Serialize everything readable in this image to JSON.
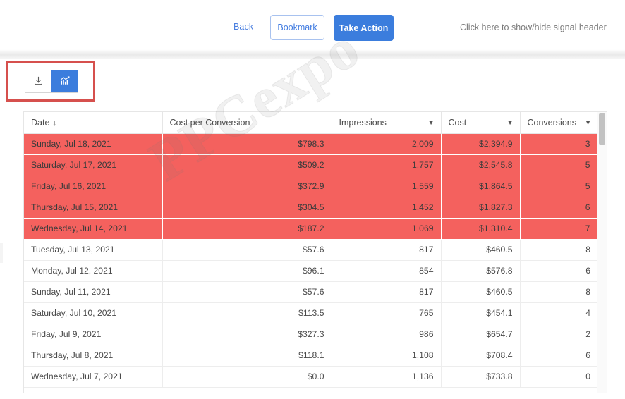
{
  "topbar": {
    "back_label": "Back",
    "bookmark_label": "Bookmark",
    "take_action_label": "Take Action",
    "signal_header_toggle": "Click here to show/hide signal header",
    "accent_blue": "#3b7ddd",
    "link_blue": "#4a7fe0"
  },
  "toolbar": {
    "download_icon": "download-icon",
    "chart_icon": "bar-chart-icon",
    "active_tool": "chart",
    "highlight_color": "#d6504d"
  },
  "watermark": {
    "text": "PPCexpo"
  },
  "table": {
    "alert_color": "#f4615e",
    "sort_column": "Date",
    "sort_direction": "↓",
    "columns": [
      {
        "label": "Date",
        "align": "left",
        "sortable": true,
        "has_caret": false,
        "sort_glyph": "↓"
      },
      {
        "label": "Cost per Conversion",
        "align": "right",
        "sortable": false,
        "has_caret": false,
        "sort_glyph": ""
      },
      {
        "label": "Impressions",
        "align": "right",
        "sortable": false,
        "has_caret": true,
        "sort_glyph": ""
      },
      {
        "label": "Cost",
        "align": "right",
        "sortable": false,
        "has_caret": true,
        "sort_glyph": ""
      },
      {
        "label": "Conversions",
        "align": "right",
        "sortable": false,
        "has_caret": true,
        "sort_glyph": ""
      }
    ],
    "rows": [
      {
        "date": "Sunday, Jul 18, 2021",
        "cost_per_conversion": "$798.3",
        "impressions": "2,009",
        "cost": "$2,394.9",
        "conversions": "3",
        "alert": true
      },
      {
        "date": "Saturday, Jul 17, 2021",
        "cost_per_conversion": "$509.2",
        "impressions": "1,757",
        "cost": "$2,545.8",
        "conversions": "5",
        "alert": true
      },
      {
        "date": "Friday, Jul 16, 2021",
        "cost_per_conversion": "$372.9",
        "impressions": "1,559",
        "cost": "$1,864.5",
        "conversions": "5",
        "alert": true
      },
      {
        "date": "Thursday, Jul 15, 2021",
        "cost_per_conversion": "$304.5",
        "impressions": "1,452",
        "cost": "$1,827.3",
        "conversions": "6",
        "alert": true
      },
      {
        "date": "Wednesday, Jul 14, 2021",
        "cost_per_conversion": "$187.2",
        "impressions": "1,069",
        "cost": "$1,310.4",
        "conversions": "7",
        "alert": true
      },
      {
        "date": "Tuesday, Jul 13, 2021",
        "cost_per_conversion": "$57.6",
        "impressions": "817",
        "cost": "$460.5",
        "conversions": "8",
        "alert": false
      },
      {
        "date": "Monday, Jul 12, 2021",
        "cost_per_conversion": "$96.1",
        "impressions": "854",
        "cost": "$576.8",
        "conversions": "6",
        "alert": false
      },
      {
        "date": "Sunday, Jul 11, 2021",
        "cost_per_conversion": "$57.6",
        "impressions": "817",
        "cost": "$460.5",
        "conversions": "8",
        "alert": false
      },
      {
        "date": "Saturday, Jul 10, 2021",
        "cost_per_conversion": "$113.5",
        "impressions": "765",
        "cost": "$454.1",
        "conversions": "4",
        "alert": false
      },
      {
        "date": "Friday, Jul 9, 2021",
        "cost_per_conversion": "$327.3",
        "impressions": "986",
        "cost": "$654.7",
        "conversions": "2",
        "alert": false
      },
      {
        "date": "Thursday, Jul 8, 2021",
        "cost_per_conversion": "$118.1",
        "impressions": "1,108",
        "cost": "$708.4",
        "conversions": "6",
        "alert": false
      },
      {
        "date": "Wednesday, Jul 7, 2021",
        "cost_per_conversion": "$0.0",
        "impressions": "1,136",
        "cost": "$733.8",
        "conversions": "0",
        "alert": false
      }
    ]
  },
  "scrollbar": {
    "orientation": "vertical",
    "thumb_position": "top"
  }
}
